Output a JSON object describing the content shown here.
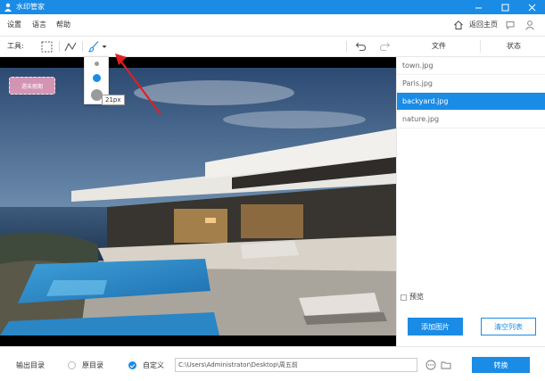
{
  "app": {
    "title": "水印管家",
    "icon": "person-icon",
    "window_controls": [
      "minimize-icon",
      "maximize-icon",
      "close-icon"
    ]
  },
  "menu": {
    "items": [
      "设置",
      "语言",
      "帮助"
    ],
    "home_label": "返回主页",
    "right_icons": [
      "home-icon",
      "chat-icon",
      "user-icon"
    ]
  },
  "toolbar": {
    "label": "工具:",
    "tools": [
      "select-rect-icon",
      "polyline-icon",
      "brush-icon",
      "dropdown-caret-icon"
    ],
    "history": [
      "undo-icon",
      "redo-icon"
    ],
    "file_header": "文件",
    "status_header": "状态"
  },
  "brush_popup": {
    "sizes": [
      "small",
      "medium",
      "large"
    ],
    "selected": "medium",
    "tooltip": "21px"
  },
  "canvas": {
    "watermark_text": "週末假期"
  },
  "files": {
    "items": [
      "town.jpg",
      "Paris.jpg",
      "backyard.jpg",
      "nature.jpg"
    ],
    "selected_index": 2,
    "preview_label": "预览",
    "add_button": "添加图片",
    "clear_button": "清空列表"
  },
  "output": {
    "label": "输出目录",
    "option_original": "原目录",
    "option_custom": "自定义",
    "selected": "custom",
    "path": "C:\\Users\\Administrator\\Desktop\\周五前",
    "convert_button": "转换"
  },
  "colors": {
    "accent": "#1a8ce6",
    "annotation_arrow": "#e02020"
  }
}
